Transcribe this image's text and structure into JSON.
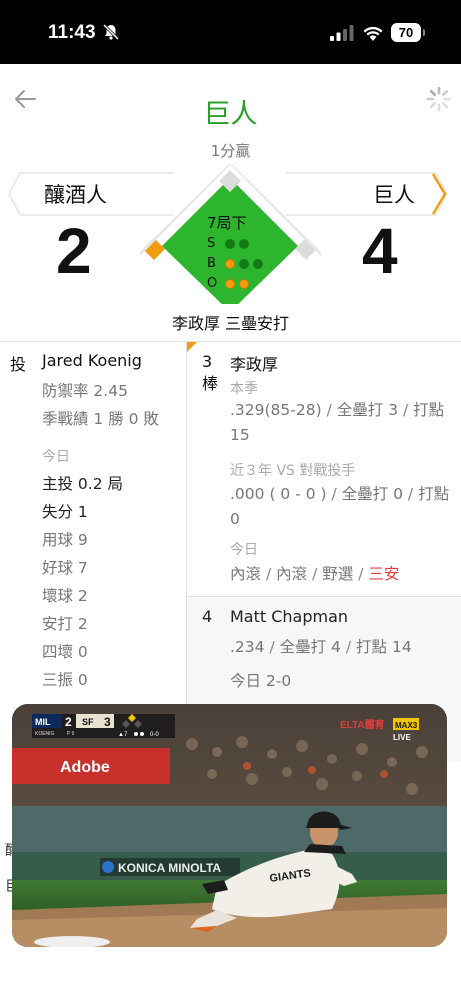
{
  "status_bar": {
    "time": "11:43",
    "battery": "70"
  },
  "header": {
    "title": "巨人",
    "subtitle": "1分贏"
  },
  "scoreboard": {
    "away_team": "釀酒人",
    "home_team": "巨人",
    "away_score": "2",
    "home_score": "4",
    "inning": "7局下",
    "count_labels": [
      "S",
      "B",
      "O"
    ],
    "strikes": 0,
    "balls": 1,
    "outs": 2,
    "play_result": "李政厚 三壘安打"
  },
  "pitcher": {
    "tag": "投",
    "name": "Jared Koenig",
    "era": "防禦率 2.45",
    "record": "季戰績 1 勝 0 敗",
    "today_label": "今日",
    "innings": "主投 0.2 局",
    "runs": "失分 1",
    "pitches": "用球 9",
    "strikes": "好球 7",
    "balls": "壞球 2",
    "hits": "安打 2",
    "walks": "四壞 0",
    "strikeouts": "三振 0"
  },
  "batter": {
    "order_number": "3",
    "order_suffix": "棒",
    "name": "李政厚",
    "season_label": "本季",
    "season_stats": [
      ".329(85-28)",
      "/",
      "全壘打 3",
      "/",
      "打點 15"
    ],
    "vs_label": "近３年 VS 對戰投手",
    "vs_stats": [
      ".000 ( 0 - 0 )",
      "/",
      "全壘打 0",
      "/",
      "打點 0"
    ],
    "today_label": "今日",
    "today_results": [
      "內滾",
      "/",
      "內滾",
      "/",
      "野選",
      "/",
      "三安"
    ]
  },
  "next_batter": {
    "order_number": "4",
    "name": "Matt Chapman",
    "stats": [
      ".234",
      "/",
      "全壘打 4",
      "/",
      "打點 14"
    ],
    "today": "今日 2-0"
  },
  "video": {
    "away_abbr": "MIL",
    "away_score": "2",
    "home_abbr": "SF",
    "home_score": "3",
    "pitcher_tag": "KOENIG",
    "pitch_count": "P 9",
    "inning": "▲7",
    "count": "0-0",
    "network": "ELTA體育",
    "channel": "MAX3",
    "live": "LIVE",
    "billboard": "Adobe",
    "banner": "KONICA MINOLTA",
    "jersey": "GIANTS"
  },
  "colors": {
    "accent_green": "#2a9d2a",
    "field_green": "#2db52d",
    "runner_orange": "#f39c12",
    "hit_red": "#e23b3b"
  }
}
